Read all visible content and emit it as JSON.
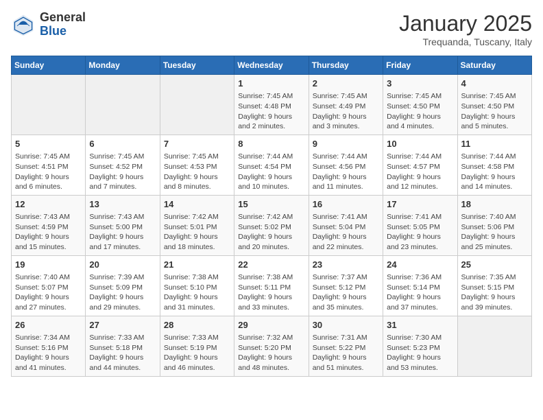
{
  "header": {
    "logo_general": "General",
    "logo_blue": "Blue",
    "month_year": "January 2025",
    "location": "Trequanda, Tuscany, Italy"
  },
  "weekdays": [
    "Sunday",
    "Monday",
    "Tuesday",
    "Wednesday",
    "Thursday",
    "Friday",
    "Saturday"
  ],
  "weeks": [
    [
      {
        "day": "",
        "info": ""
      },
      {
        "day": "",
        "info": ""
      },
      {
        "day": "",
        "info": ""
      },
      {
        "day": "1",
        "info": "Sunrise: 7:45 AM\nSunset: 4:48 PM\nDaylight: 9 hours and 2 minutes."
      },
      {
        "day": "2",
        "info": "Sunrise: 7:45 AM\nSunset: 4:49 PM\nDaylight: 9 hours and 3 minutes."
      },
      {
        "day": "3",
        "info": "Sunrise: 7:45 AM\nSunset: 4:50 PM\nDaylight: 9 hours and 4 minutes."
      },
      {
        "day": "4",
        "info": "Sunrise: 7:45 AM\nSunset: 4:50 PM\nDaylight: 9 hours and 5 minutes."
      }
    ],
    [
      {
        "day": "5",
        "info": "Sunrise: 7:45 AM\nSunset: 4:51 PM\nDaylight: 9 hours and 6 minutes."
      },
      {
        "day": "6",
        "info": "Sunrise: 7:45 AM\nSunset: 4:52 PM\nDaylight: 9 hours and 7 minutes."
      },
      {
        "day": "7",
        "info": "Sunrise: 7:45 AM\nSunset: 4:53 PM\nDaylight: 9 hours and 8 minutes."
      },
      {
        "day": "8",
        "info": "Sunrise: 7:44 AM\nSunset: 4:54 PM\nDaylight: 9 hours and 10 minutes."
      },
      {
        "day": "9",
        "info": "Sunrise: 7:44 AM\nSunset: 4:56 PM\nDaylight: 9 hours and 11 minutes."
      },
      {
        "day": "10",
        "info": "Sunrise: 7:44 AM\nSunset: 4:57 PM\nDaylight: 9 hours and 12 minutes."
      },
      {
        "day": "11",
        "info": "Sunrise: 7:44 AM\nSunset: 4:58 PM\nDaylight: 9 hours and 14 minutes."
      }
    ],
    [
      {
        "day": "12",
        "info": "Sunrise: 7:43 AM\nSunset: 4:59 PM\nDaylight: 9 hours and 15 minutes."
      },
      {
        "day": "13",
        "info": "Sunrise: 7:43 AM\nSunset: 5:00 PM\nDaylight: 9 hours and 17 minutes."
      },
      {
        "day": "14",
        "info": "Sunrise: 7:42 AM\nSunset: 5:01 PM\nDaylight: 9 hours and 18 minutes."
      },
      {
        "day": "15",
        "info": "Sunrise: 7:42 AM\nSunset: 5:02 PM\nDaylight: 9 hours and 20 minutes."
      },
      {
        "day": "16",
        "info": "Sunrise: 7:41 AM\nSunset: 5:04 PM\nDaylight: 9 hours and 22 minutes."
      },
      {
        "day": "17",
        "info": "Sunrise: 7:41 AM\nSunset: 5:05 PM\nDaylight: 9 hours and 23 minutes."
      },
      {
        "day": "18",
        "info": "Sunrise: 7:40 AM\nSunset: 5:06 PM\nDaylight: 9 hours and 25 minutes."
      }
    ],
    [
      {
        "day": "19",
        "info": "Sunrise: 7:40 AM\nSunset: 5:07 PM\nDaylight: 9 hours and 27 minutes."
      },
      {
        "day": "20",
        "info": "Sunrise: 7:39 AM\nSunset: 5:09 PM\nDaylight: 9 hours and 29 minutes."
      },
      {
        "day": "21",
        "info": "Sunrise: 7:38 AM\nSunset: 5:10 PM\nDaylight: 9 hours and 31 minutes."
      },
      {
        "day": "22",
        "info": "Sunrise: 7:38 AM\nSunset: 5:11 PM\nDaylight: 9 hours and 33 minutes."
      },
      {
        "day": "23",
        "info": "Sunrise: 7:37 AM\nSunset: 5:12 PM\nDaylight: 9 hours and 35 minutes."
      },
      {
        "day": "24",
        "info": "Sunrise: 7:36 AM\nSunset: 5:14 PM\nDaylight: 9 hours and 37 minutes."
      },
      {
        "day": "25",
        "info": "Sunrise: 7:35 AM\nSunset: 5:15 PM\nDaylight: 9 hours and 39 minutes."
      }
    ],
    [
      {
        "day": "26",
        "info": "Sunrise: 7:34 AM\nSunset: 5:16 PM\nDaylight: 9 hours and 41 minutes."
      },
      {
        "day": "27",
        "info": "Sunrise: 7:33 AM\nSunset: 5:18 PM\nDaylight: 9 hours and 44 minutes."
      },
      {
        "day": "28",
        "info": "Sunrise: 7:33 AM\nSunset: 5:19 PM\nDaylight: 9 hours and 46 minutes."
      },
      {
        "day": "29",
        "info": "Sunrise: 7:32 AM\nSunset: 5:20 PM\nDaylight: 9 hours and 48 minutes."
      },
      {
        "day": "30",
        "info": "Sunrise: 7:31 AM\nSunset: 5:22 PM\nDaylight: 9 hours and 51 minutes."
      },
      {
        "day": "31",
        "info": "Sunrise: 7:30 AM\nSunset: 5:23 PM\nDaylight: 9 hours and 53 minutes."
      },
      {
        "day": "",
        "info": ""
      }
    ]
  ]
}
